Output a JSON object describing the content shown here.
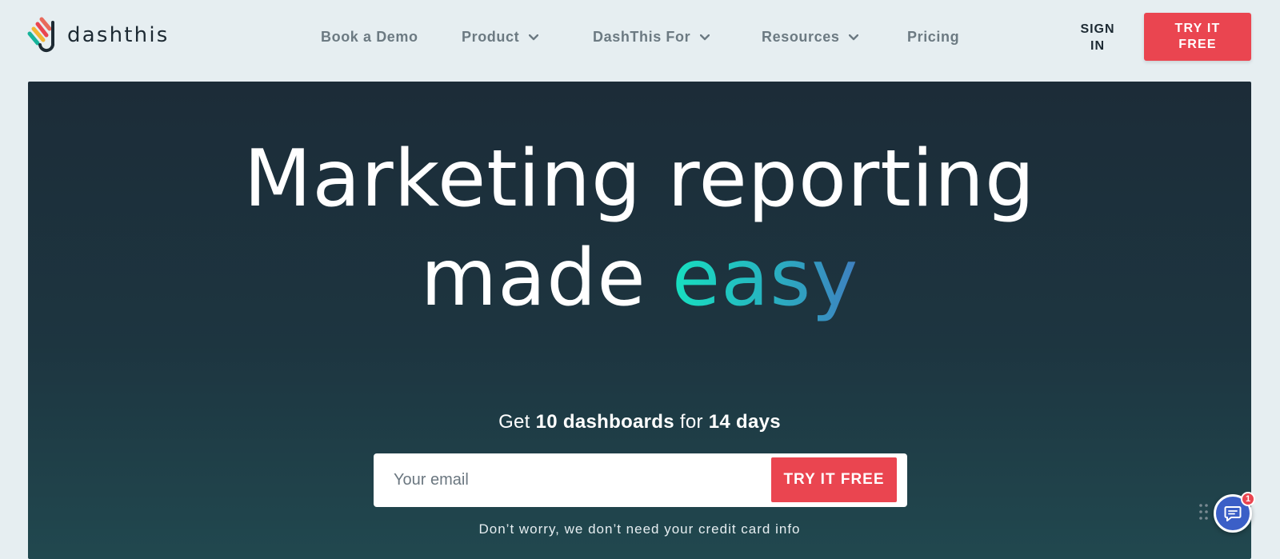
{
  "header": {
    "logo_text": "dashthis",
    "nav": [
      {
        "label": "Book a Demo",
        "has_dropdown": false
      },
      {
        "label": "Product",
        "has_dropdown": true
      },
      {
        "label": "DashThis For",
        "has_dropdown": true
      },
      {
        "label": "Resources",
        "has_dropdown": true
      },
      {
        "label": "Pricing",
        "has_dropdown": false
      }
    ],
    "sign_in_line1": "SIGN",
    "sign_in_line2": "IN",
    "try_line1": "TRY IT",
    "try_line2": "FREE"
  },
  "hero": {
    "headline_line1": "Marketing reporting",
    "headline_line2_prefix": "made ",
    "headline_accent": "easy",
    "offer_prefix": "Get ",
    "offer_count": "10 dashboards",
    "offer_mid": " for ",
    "offer_days": "14 days",
    "email_placeholder": "Your email",
    "submit_label": "TRY IT FREE",
    "disclaimer": "Don’t worry, we don’t need your credit card info"
  },
  "chat": {
    "badge_count": "1",
    "icon": "chat-bubble-icon"
  },
  "colors": {
    "accent_red": "#ea4550",
    "hero_dark": "#1c2c38",
    "accent_gradient_start": "#17e0c0",
    "accent_gradient_end": "#3f7fc0"
  }
}
